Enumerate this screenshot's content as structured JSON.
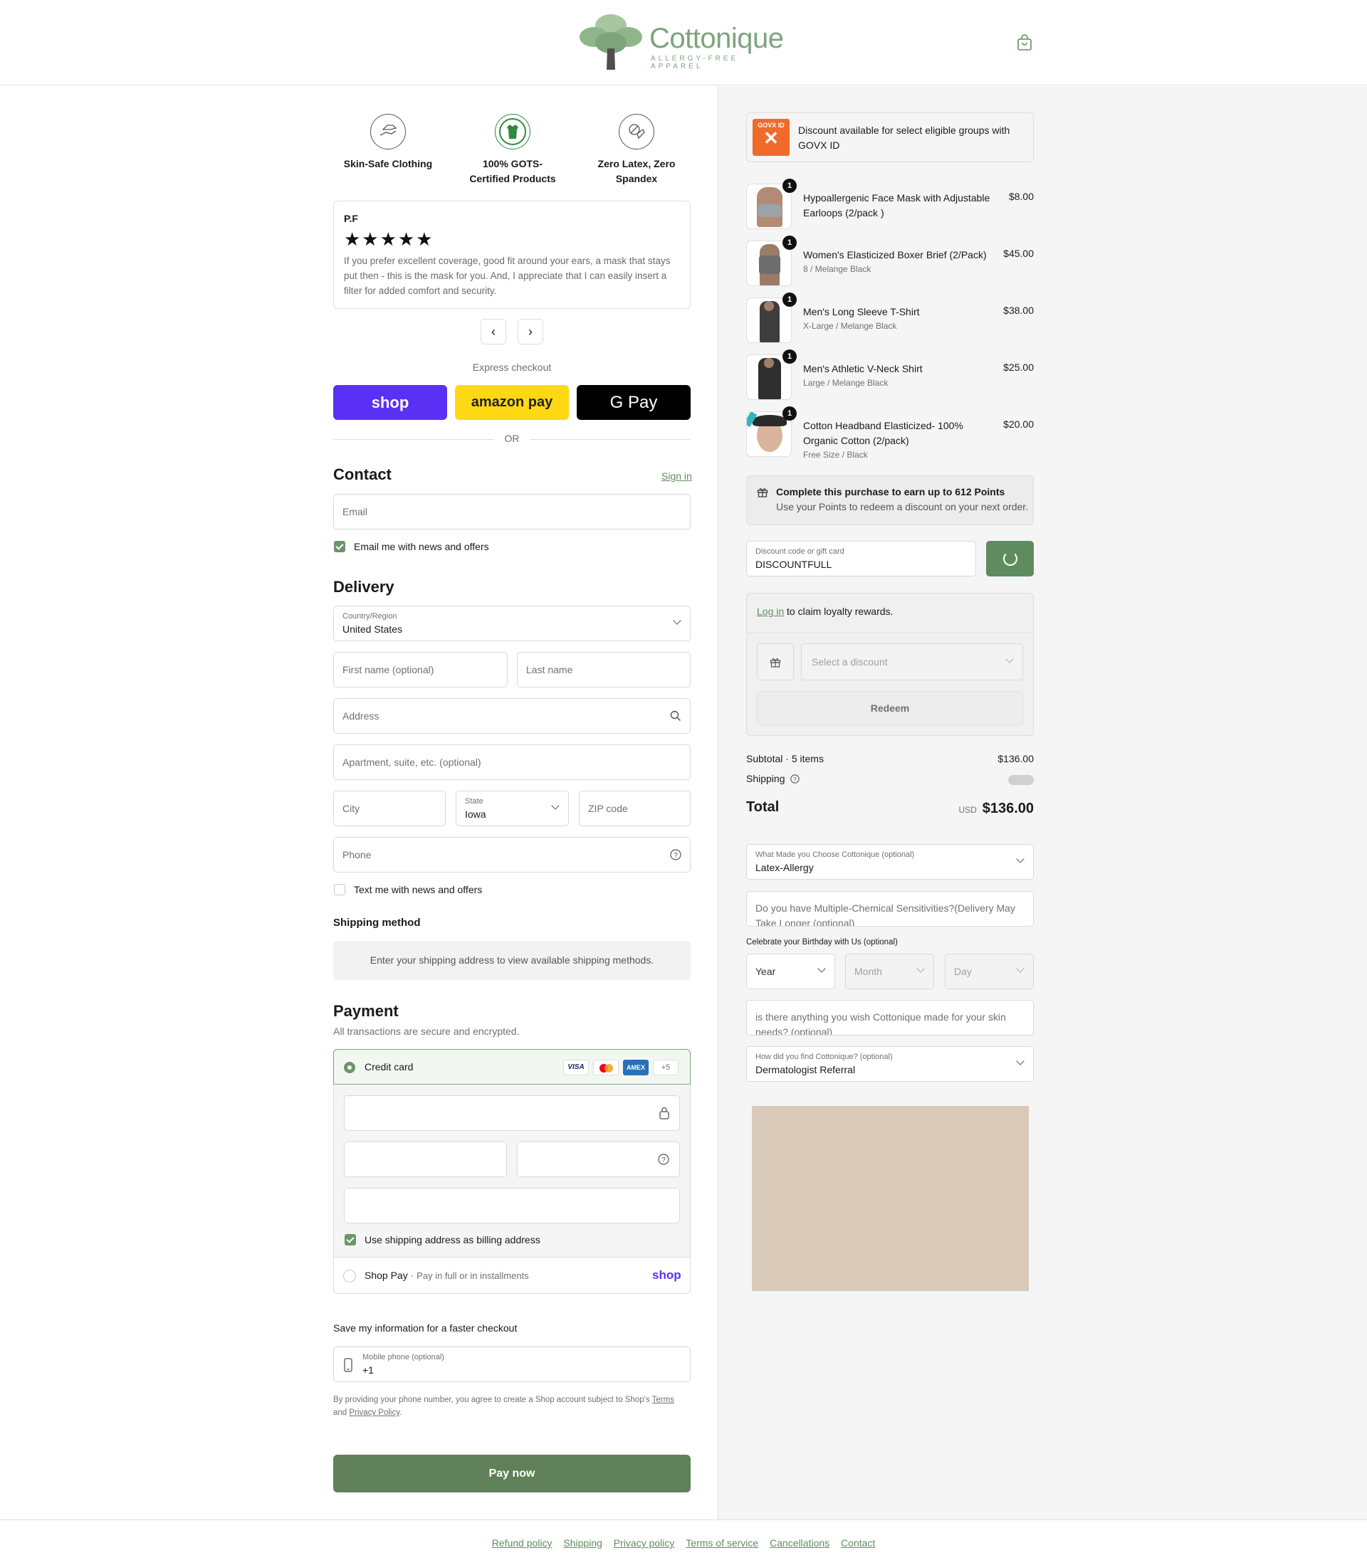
{
  "header": {
    "brand": "Cottonique",
    "tagline": "ALLERGY-FREE APPAREL",
    "cart_icon": "shopping-bag-icon"
  },
  "badges": [
    {
      "label": "Skin-Safe Clothing",
      "icon": "hands-shirt-icon"
    },
    {
      "label": "100% GOTS-Certified Products",
      "icon": "gots-certified-icon"
    },
    {
      "label": "Zero Latex, Zero Spandex",
      "icon": "no-latex-icon"
    }
  ],
  "review": {
    "author": "P.F",
    "rating": 5,
    "stars": "★★★★★",
    "text": "If you prefer excellent coverage, good fit around your ears, a mask that stays put then - this is the mask for you. And, I appreciate that I can easily insert a filter for added comfort and security."
  },
  "express": {
    "label": "Express checkout",
    "shop": "shop",
    "amazon": "amazon pay",
    "gpay": "G Pay",
    "or": "OR"
  },
  "contact": {
    "title": "Contact",
    "sign_in": "Sign in",
    "email_placeholder": "Email",
    "news_label": "Email me with news and offers"
  },
  "delivery": {
    "title": "Delivery",
    "country_label": "Country/Region",
    "country_value": "United States",
    "first_name": "First name (optional)",
    "last_name": "Last name",
    "address": "Address",
    "apartment": "Apartment, suite, etc. (optional)",
    "city": "City",
    "state_label": "State",
    "state_value": "Iowa",
    "zip": "ZIP code",
    "phone": "Phone",
    "text_label": "Text me with news and offers"
  },
  "shipping": {
    "title": "Shipping method",
    "info": "Enter your shipping address to view available shipping methods."
  },
  "payment": {
    "title": "Payment",
    "subtitle": "All transactions are secure and encrypted.",
    "credit_card": "Credit card",
    "cards": [
      "VISA",
      "MC",
      "AMEX"
    ],
    "more_cards": "+5",
    "billing_label": "Use shipping address as billing address",
    "shop_pay": "Shop Pay",
    "shop_pay_desc": "Pay in full or in installments",
    "shop_pay_logo": "shop"
  },
  "save_info": {
    "title": "Save my information for a faster checkout",
    "mobile_label": "Mobile phone (optional)",
    "mobile_value": "+1",
    "legal_1": "By providing your phone number, you agree to create a Shop account subject to Shop's",
    "terms": "Terms",
    "and": "and",
    "privacy": "Privacy Policy",
    "period": "."
  },
  "pay_now": "Pay now",
  "govx": {
    "logo": "GOVX ID",
    "text": "Discount available for select eligible groups with GOVX ID"
  },
  "cart_items": [
    {
      "qty": "1",
      "name": "Hypoallergenic Face Mask with Adjustable Earloops (2/pack )",
      "variant": "",
      "price": "$8.00"
    },
    {
      "qty": "1",
      "name": "Women's Elasticized Boxer Brief (2/Pack)",
      "variant": "8 / Melange Black",
      "price": "$45.00"
    },
    {
      "qty": "1",
      "name": "Men's Long Sleeve T-Shirt",
      "variant": "X-Large / Melange Black",
      "price": "$38.00"
    },
    {
      "qty": "1",
      "name": "Men's Athletic V-Neck Shirt",
      "variant": "Large / Melange Black",
      "price": "$25.00"
    },
    {
      "qty": "1",
      "name": "Cotton Headband Elasticized- 100% Organic Cotton (2/pack)",
      "variant": "Free Size / Black",
      "price": "$20.00"
    }
  ],
  "points": {
    "title": "Complete this purchase to earn up to 612 Points",
    "sub": "Use your Points to redeem a discount on your next order."
  },
  "discount": {
    "label": "Discount code or gift card",
    "value": "DISCOUNTFULL"
  },
  "loyalty": {
    "login": "Log in",
    "text": " to claim loyalty rewards.",
    "select_placeholder": "Select a discount",
    "redeem": "Redeem"
  },
  "summary": {
    "subtotal_label": "Subtotal · 5 items",
    "subtotal": "$136.00",
    "shipping_label": "Shipping",
    "total_label": "Total",
    "currency": "USD",
    "total": "$136.00"
  },
  "survey": {
    "choose_label": "What Made you Choose Cottonique (optional)",
    "choose_value": "Latex-Allergy",
    "mcs_placeholder": "Do you have Multiple-Chemical Sensitivities?(Delivery May Take Longer (optional)",
    "birthday_label": "Celebrate your Birthday with Us (optional)",
    "year": "Year",
    "month": "Month",
    "day": "Day",
    "wish_placeholder": "is there anything you wish Cottonique made for your skin needs? (optional)",
    "find_label": "How did you find Cottonique? (optional)",
    "find_value": "Dermatologist Referral"
  },
  "footer": [
    "Refund policy",
    "Shipping",
    "Privacy policy",
    "Terms of service",
    "Cancellations",
    "Contact"
  ]
}
